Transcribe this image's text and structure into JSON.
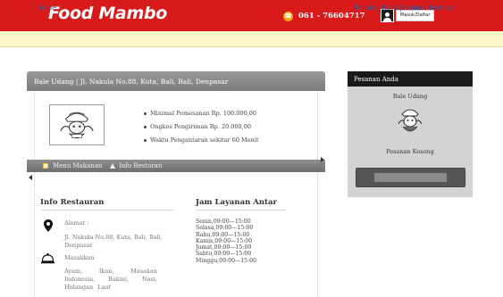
{
  "header": {
    "logo": "Food Mambo",
    "phone": "061 - 76604717",
    "login_label": "Masuk/Daftar",
    "icons": {
      "phone": "phone-icon",
      "user": "user-icon"
    },
    "colors": {
      "bar": "#d91a1a",
      "phone_icon": "#f2a91c"
    }
  },
  "nav": {
    "home": "Home",
    "about": "Tentang Kami",
    "separator": " | ",
    "all_restaurants": "Semua Restoran"
  },
  "restaurant": {
    "header": "Bale Udang | Jl. Nakula No.88, Kuta, Bali, Bali, Denpasar",
    "info": [
      "Minimal Pemesanan Rp. 100.000,00",
      "Ongkos Pengiriman Rp. 20.000,00",
      "Waktu Pengantaran sekitar 60 Menit"
    ],
    "tabs": {
      "menu": "Menu Makanan",
      "info": "Info Restoran"
    }
  },
  "info_restaurant": {
    "title": "Info Restauran",
    "address_label": "Alamat :",
    "address": "Jl. Nakula No.88, Kuta, Bali, Bali, Denpasar",
    "cuisine_label": "Masakkan",
    "cuisine": "Ayam, Ikan, Masakan Indonesia, Bakmi, Nasi, Hidangan Laut"
  },
  "delivery_hours": {
    "title": "Jam Layanan Antar",
    "days": [
      "Senin,09:00—15:00",
      "Selasa,09:00—15:00",
      "Rabu,09:00—15:00",
      "Kamis,09:00—15:00",
      "Jumat,09:00—15:00",
      "Sabtu,09:00—15:00",
      "Minggu,09:00—15:00"
    ]
  },
  "order": {
    "title": "Pesanan Anda",
    "restaurant": "Bale Udang",
    "empty": "Pesanan Kosong"
  }
}
